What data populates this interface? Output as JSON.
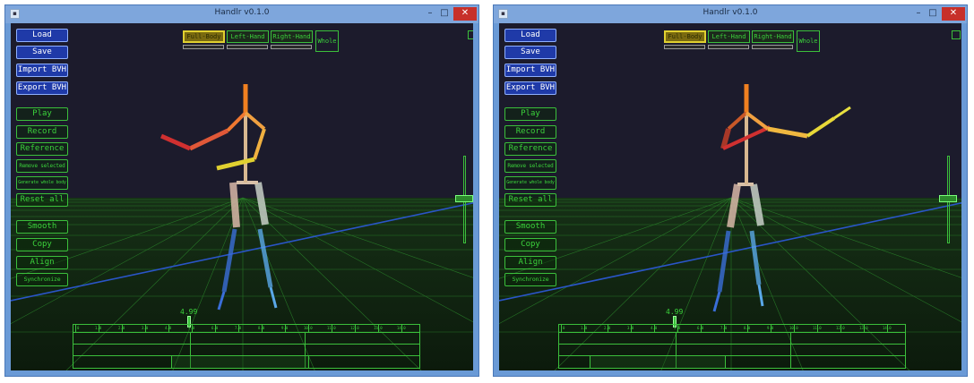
{
  "windows": [
    {
      "title": "Handlr v0.1.0",
      "sidebar": {
        "file_buttons": [
          "Load",
          "Save",
          "Import BVH",
          "Export BVH"
        ],
        "action_buttons": [
          "Play",
          "Record",
          "Reference",
          "Remove selected",
          "Generate whole body",
          "Reset all"
        ],
        "edit_buttons": [
          "Smooth",
          "Copy",
          "Align",
          "Synchronize"
        ]
      },
      "tabs": [
        "Full-Body",
        "Left-Hand",
        "Right-Hand"
      ],
      "active_tab": "Full-Body",
      "whole_label": "Whole",
      "timeline": {
        "current_time": "4.99",
        "ticks": [
          "0",
          "1.0",
          "2.0",
          "3.0",
          "4.0",
          "5.0",
          "6.0",
          "7.0",
          "8.0",
          "9.0",
          "10.0",
          "11.0",
          "12.0",
          "13.0",
          "14.0"
        ]
      }
    },
    {
      "title": "Handlr v0.1.0",
      "sidebar": {
        "file_buttons": [
          "Load",
          "Save",
          "Import BVH",
          "Export BVH"
        ],
        "action_buttons": [
          "Play",
          "Record",
          "Reference",
          "Remove selected",
          "Generate whole body",
          "Reset all"
        ],
        "edit_buttons": [
          "Smooth",
          "Copy",
          "Align",
          "Synchronize"
        ]
      },
      "tabs": [
        "Full-Body",
        "Left-Hand",
        "Right-Hand"
      ],
      "active_tab": "Full-Body",
      "whole_label": "Whole",
      "timeline": {
        "current_time": "4.99",
        "ticks": [
          "0",
          "1.0",
          "2.0",
          "3.0",
          "4.0",
          "5.0",
          "6.0",
          "7.0",
          "8.0",
          "9.0",
          "10.0",
          "11.0",
          "12.0",
          "13.0",
          "14.0"
        ]
      }
    }
  ],
  "colors": {
    "viewport_bg": "#1c1b2c",
    "ui_green": "#3bd23b",
    "button_blue": "#1f3aa8",
    "titlebar": "#7ea6dc",
    "close_red": "#c7302a",
    "active_tab": "#e0d030"
  },
  "icons": {
    "app": "app-icon",
    "minimize": "minimize-icon",
    "maximize": "maximize-icon",
    "close": "close-icon"
  }
}
